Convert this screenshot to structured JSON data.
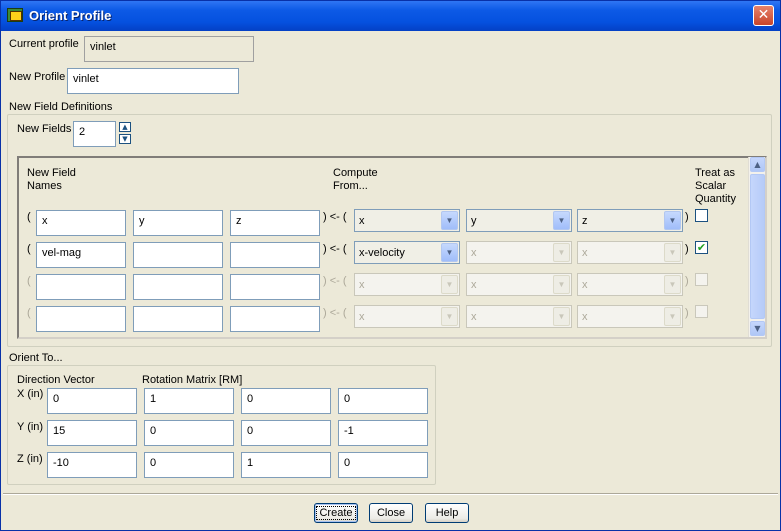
{
  "window": {
    "title": "Orient Profile"
  },
  "current_profile": {
    "label": "Current profile",
    "value": "vinlet"
  },
  "new_profile": {
    "label": "New Profile",
    "value": "vinlet"
  },
  "field_defs": {
    "group_label": "New Field Definitions",
    "new_fields_label": "New Fields",
    "new_fields_value": "2",
    "headers": {
      "names": "New Field\nNames",
      "compute": "Compute\nFrom...",
      "scalar": "Treat as\nScalar\nQuantity"
    },
    "arrow": "<- (",
    "open_paren": "(",
    "close_paren": ")",
    "rows": [
      {
        "names": [
          "x",
          "y",
          "z"
        ],
        "compute": [
          "x",
          "y",
          "z"
        ],
        "scalar": false,
        "enabled": true
      },
      {
        "names": [
          "vel-mag",
          "",
          ""
        ],
        "compute": [
          "x-velocity",
          "x",
          "x"
        ],
        "scalar": true,
        "enabled": true
      },
      {
        "names": [
          "",
          "",
          ""
        ],
        "compute": [
          "x",
          "x",
          "x"
        ],
        "scalar": false,
        "enabled": false
      },
      {
        "names": [
          "",
          "",
          ""
        ],
        "compute": [
          "x",
          "x",
          "x"
        ],
        "scalar": false,
        "enabled": false
      }
    ]
  },
  "orient": {
    "group_label": "Orient To...",
    "direction_label": "Direction Vector",
    "matrix_label": "Rotation Matrix [RM]",
    "rows": [
      {
        "label": "X (in)",
        "direction": "0",
        "matrix": [
          "1",
          "0",
          "0"
        ]
      },
      {
        "label": "Y (in)",
        "direction": "15",
        "matrix": [
          "0",
          "0",
          "-1"
        ]
      },
      {
        "label": "Z (in)",
        "direction": "-10",
        "matrix": [
          "0",
          "1",
          "0"
        ]
      }
    ]
  },
  "buttons": {
    "create": "Create",
    "close": "Close",
    "help": "Help"
  },
  "icons": {
    "app": "app-icon",
    "close": "close-icon",
    "spin_up": "spin-up-icon",
    "spin_down": "spin-down-icon",
    "dropdown": "dropdown-arrow-icon",
    "scroll_up": "scroll-up-icon",
    "scroll_down": "scroll-down-icon",
    "check": "check-icon"
  },
  "colors": {
    "titlebar": "#0551df",
    "background": "#ece9d8",
    "check": "#21a121"
  }
}
